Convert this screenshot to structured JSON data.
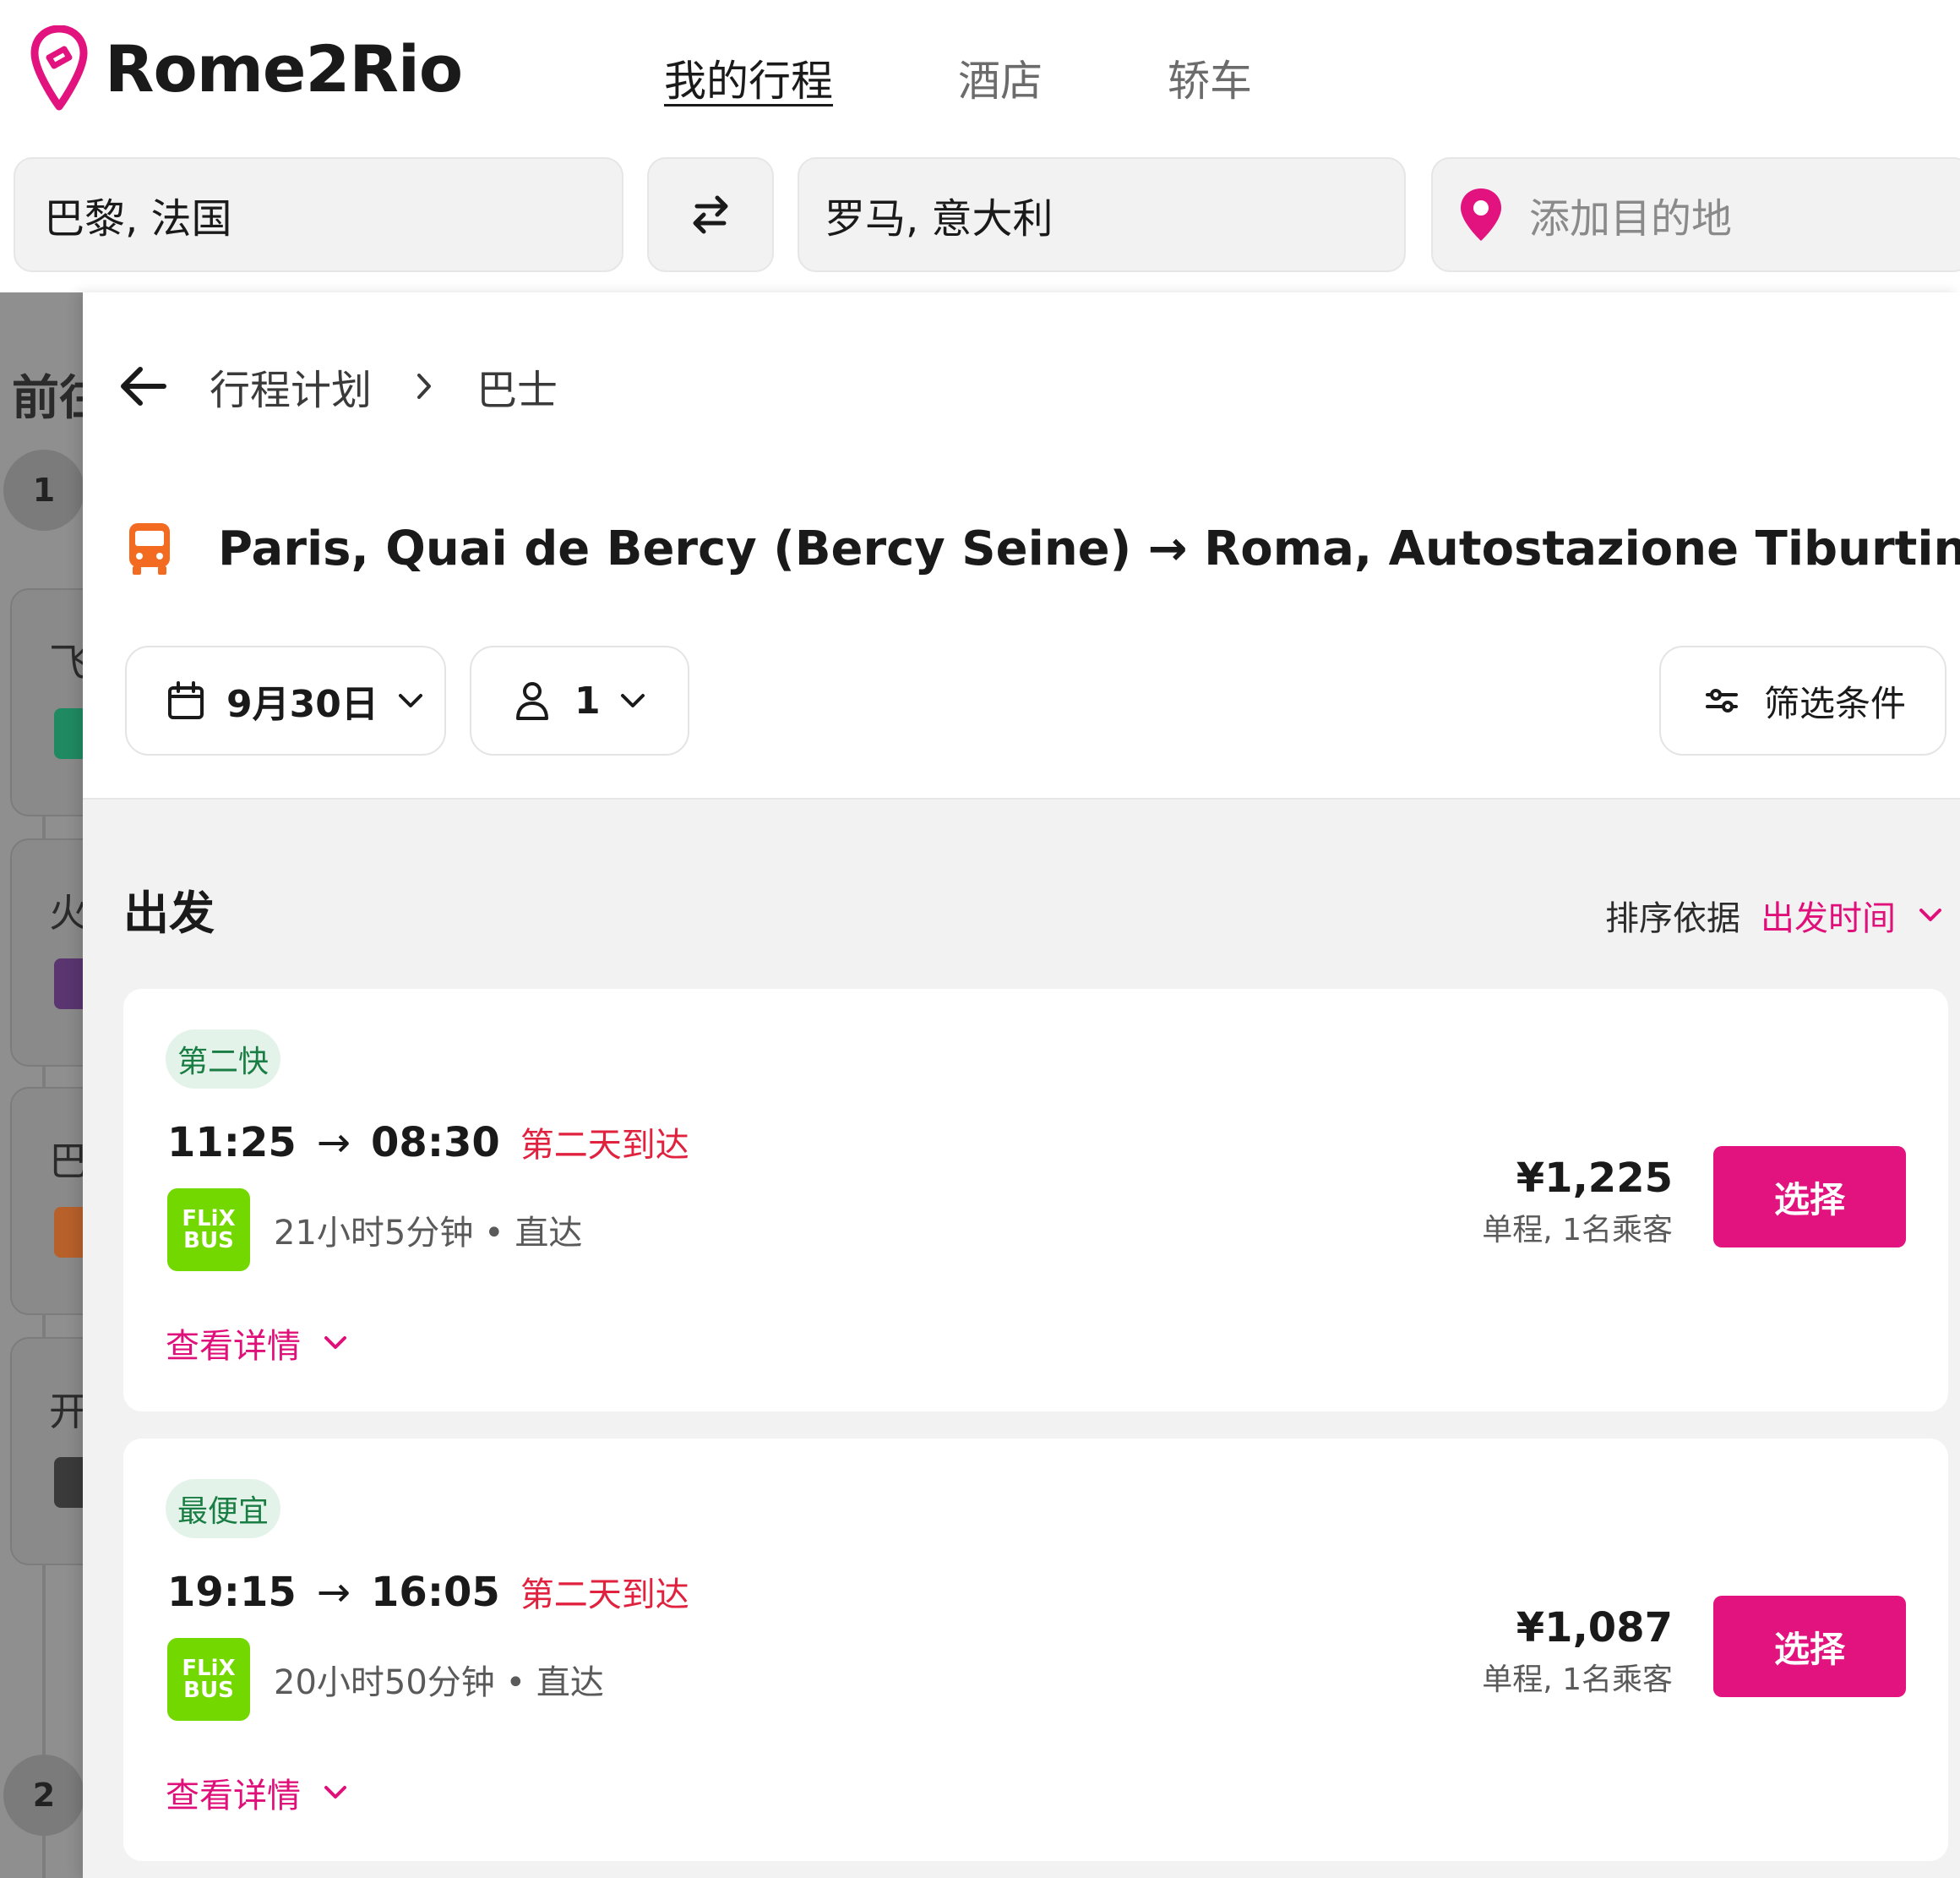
{
  "brand": {
    "name": "Rome2Rio",
    "color": "#e2127f",
    "icon": "rome2rio-pin-logo"
  },
  "nav": [
    {
      "label": "我的行程",
      "active": true
    },
    {
      "label": "酒店",
      "active": false
    },
    {
      "label": "轿车",
      "active": false
    }
  ],
  "search": {
    "from": "巴黎, 法国",
    "to": "罗马, 意大利",
    "add_placeholder": "添加目的地",
    "swap_icon": "swap-arrows-icon"
  },
  "background_panel": {
    "title": "前往",
    "step_1": "1",
    "step_2": "2",
    "cards": [
      {
        "label": "飞",
        "icon": "plane-icon",
        "color": "#1a9a6a"
      },
      {
        "label": "火",
        "icon": "train-icon",
        "color": "#6a3a8a"
      },
      {
        "label": "巴",
        "icon": "bus-icon",
        "color": "#d86a20"
      },
      {
        "label": "开",
        "icon": "car-icon",
        "color": "#333333"
      }
    ]
  },
  "breadcrumb": {
    "parent": "行程计划",
    "current": "巴士"
  },
  "route": {
    "title": "Paris, Quai de Bercy (Bercy Seine) → Roma, Autostazione Tiburtina",
    "icon": "bus-icon",
    "icon_color": "#f26b21"
  },
  "controls": {
    "date": "9月30日",
    "passengers": "1",
    "filter_label": "筛选条件"
  },
  "departures": {
    "title": "出发",
    "sort_label": "排序依据",
    "sort_value": "出发时间"
  },
  "results": [
    {
      "badge": "第二快",
      "depart": "11:25",
      "arrow": "→",
      "arrive": "08:30",
      "next_day": "第二天到达",
      "operator_logo": [
        "FLiX",
        "BUS"
      ],
      "duration": "21小时5分钟 • 直达",
      "price": "¥1,225",
      "price_note": "单程, 1名乘客",
      "select_label": "选择",
      "details_label": "查看详情"
    },
    {
      "badge": "最便宜",
      "depart": "19:15",
      "arrow": "→",
      "arrive": "16:05",
      "next_day": "第二天到达",
      "operator_logo": [
        "FLiX",
        "BUS"
      ],
      "duration": "20小时50分钟 • 直达",
      "price": "¥1,087",
      "price_note": "单程, 1名乘客",
      "select_label": "选择",
      "details_label": "查看详情"
    }
  ]
}
